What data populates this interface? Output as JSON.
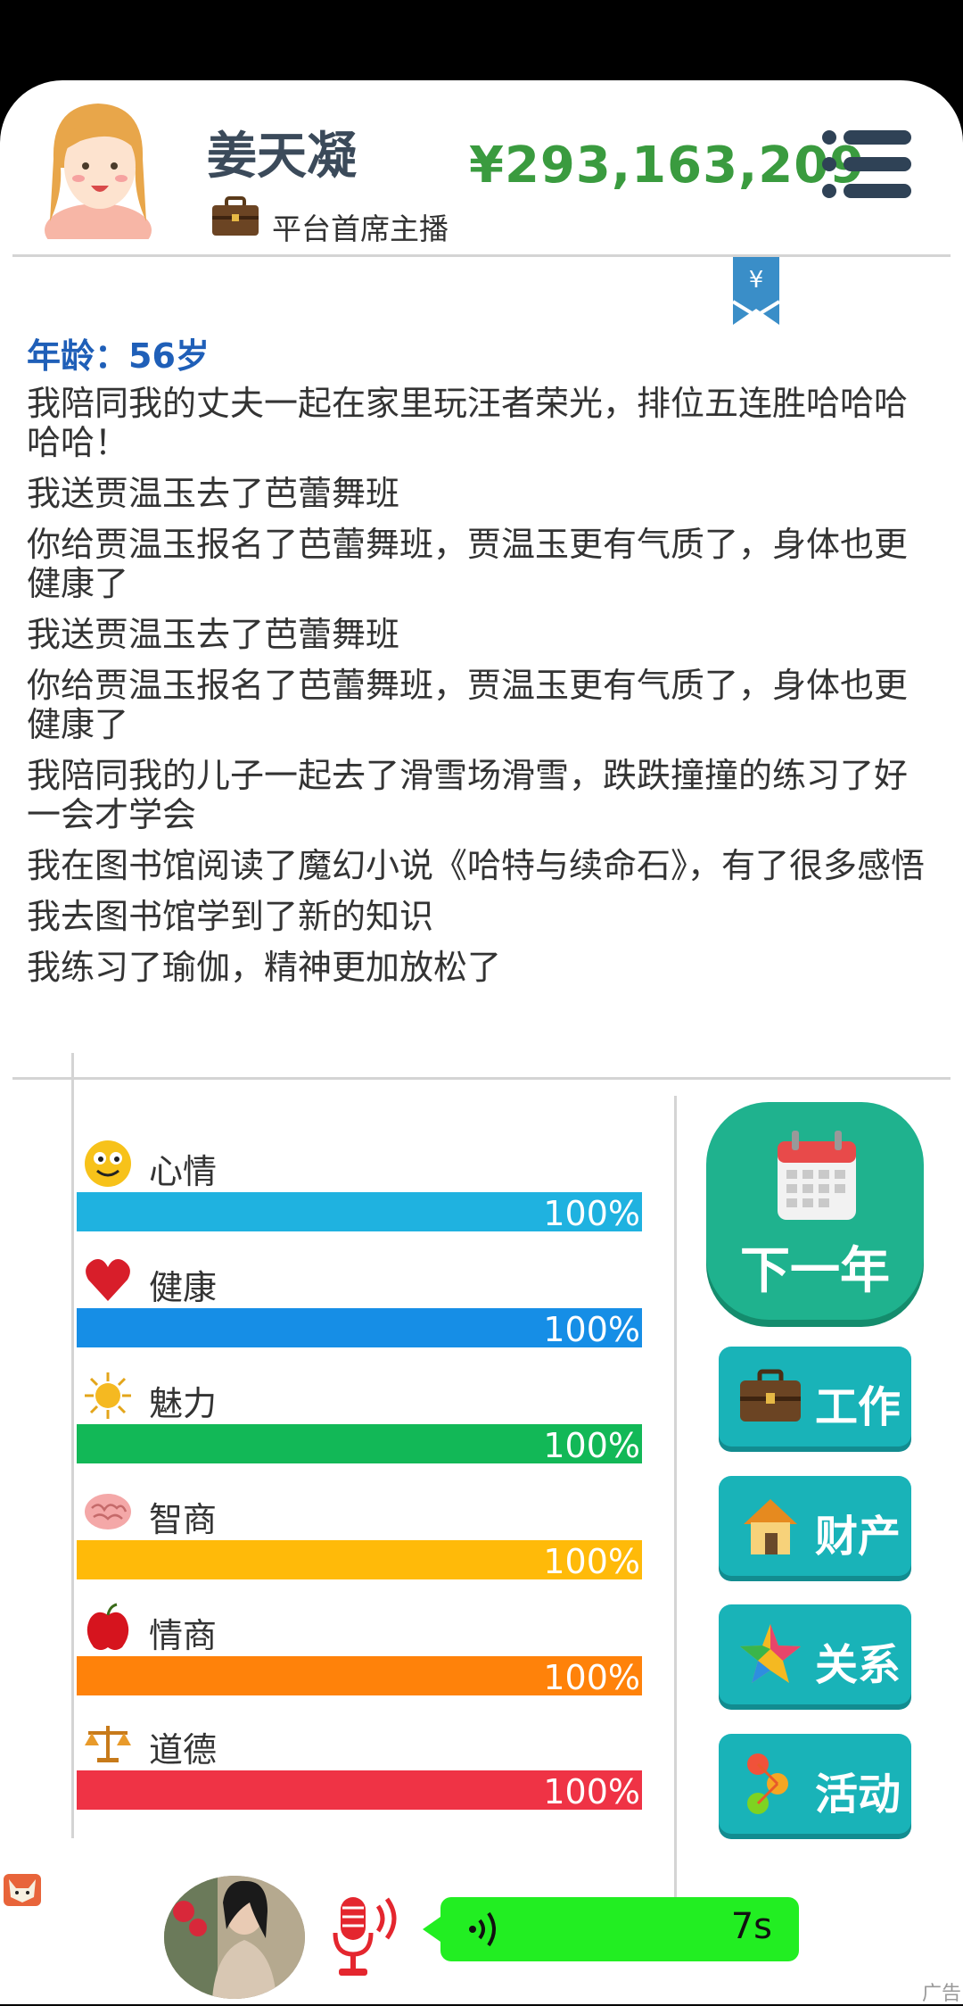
{
  "profile": {
    "name": "姜天凝",
    "job": "平台首席主播",
    "money": "¥293,163,209"
  },
  "log": {
    "age": "年龄：56岁",
    "entries": [
      "我陪同我的丈夫一起在家里玩汪者荣光，排位五连胜哈哈哈哈哈！",
      "我送贾温玉去了芭蕾舞班",
      "你给贾温玉报名了芭蕾舞班，贾温玉更有气质了，身体也更健康了",
      "我送贾温玉去了芭蕾舞班",
      "你给贾温玉报名了芭蕾舞班，贾温玉更有气质了，身体也更健康了",
      "我陪同我的儿子一起去了滑雪场滑雪，跌跌撞撞的练习了好一会才学会",
      "我在图书馆阅读了魔幻小说《哈特与续命石》，有了很多感悟",
      "我去图书馆学到了新的知识",
      "我练习了瑜伽，精神更加放松了"
    ]
  },
  "stats": [
    {
      "label": "心情",
      "value": 100,
      "pct": "100%",
      "color": "#1fb2e0",
      "icon": "smiley-icon"
    },
    {
      "label": "健康",
      "value": 100,
      "pct": "100%",
      "color": "#168ee6",
      "icon": "heart-icon"
    },
    {
      "label": "魅力",
      "value": 100,
      "pct": "100%",
      "color": "#12b857",
      "icon": "sun-icon"
    },
    {
      "label": "智商",
      "value": 100,
      "pct": "100%",
      "color": "#ffba09",
      "icon": "brain-icon"
    },
    {
      "label": "情商",
      "value": 100,
      "pct": "100%",
      "color": "#ff820a",
      "icon": "apple-icon"
    },
    {
      "label": "道德",
      "value": 100,
      "pct": "100%",
      "color": "#ef3345",
      "icon": "scales-icon"
    }
  ],
  "actions": {
    "next_year": "下一年",
    "work": "工作",
    "property": "财产",
    "relations": "关系",
    "activities": "活动"
  },
  "voice": {
    "duration": "7s"
  },
  "ad_label": "广告"
}
